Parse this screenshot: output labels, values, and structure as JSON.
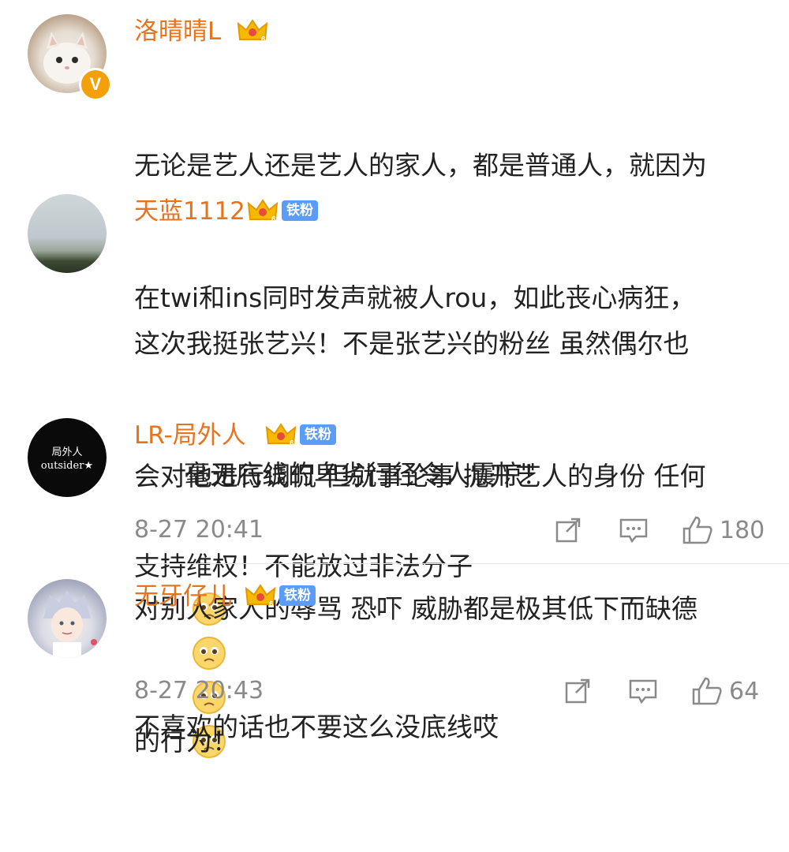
{
  "comments": [
    {
      "username": "洛晴晴L",
      "crown_level": "6",
      "verified_badge": "V",
      "text_lines": [
        "无论是艺人还是艺人的家人，都是普通人，就因为",
        "在twi和ins同时发声就被人rou，如此丧心病狂，",
        "毫无底线的卑劣行径令人震惊！"
      ],
      "emoji": "sad-face-emoji"
    },
    {
      "username": "天蓝1112",
      "crown_level": "6",
      "fan_badge": "铁粉",
      "text_lines": [
        "这次我挺张艺兴！不是张艺兴的粉丝 虽然偶尔也",
        "会对他进行调侃 但就事论事 抛开艺人的身份 任何",
        "对别人家人的辱骂 恐吓 威胁都是极其低下而缺德",
        "的行为！"
      ]
    },
    {
      "username": "LR-局外人",
      "crown_level": "6",
      "fan_badge": "铁粉",
      "avatar_text_1": "局外人",
      "avatar_text_2": "outsider★",
      "text_lines": [
        "支持维权！不能放过非法分子"
      ],
      "timestamp": "8-27 20:41",
      "likes": "180"
    },
    {
      "username": "无牙仔儿",
      "crown_level": "6",
      "fan_badge": "铁粉",
      "text_lines": [
        "不喜欢的话也不要这么没底线哎"
      ],
      "timestamp": "8-27 20:43",
      "likes": "64"
    }
  ],
  "colors": {
    "username": "#e8731d",
    "fan_badge": "#5a9cf8",
    "text": "#222222",
    "meta": "#8a8a8a"
  },
  "icons": [
    "share-icon",
    "comment-icon",
    "like-icon",
    "crown-icon"
  ]
}
